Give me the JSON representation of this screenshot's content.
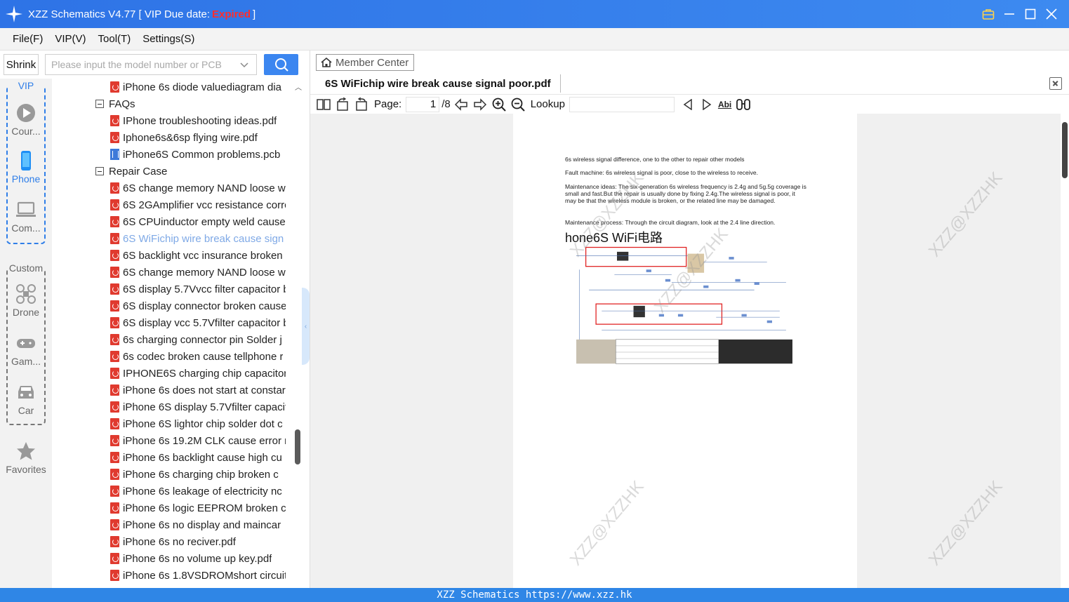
{
  "window": {
    "title_prefix": "XZZ Schematics V4.77 [ VIP Due date: ",
    "title_status": "Expired",
    "title_suffix": " ]",
    "accent_color": "#3b86f0",
    "expired_color": "#ff2d2d"
  },
  "menu": [
    "File(F)",
    "VIP(V)",
    "Tool(T)",
    "Settings(S)"
  ],
  "search": {
    "shrink_label": "Shrink",
    "placeholder": "Please input the model number or PCB"
  },
  "categories": {
    "vip_label": "VIP",
    "vip_items": [
      "Cour...",
      "Phone",
      "Com..."
    ],
    "custom_label": "Custom",
    "custom_items": [
      "Drone",
      "Gam...",
      "Car"
    ],
    "favorites": "Favorites"
  },
  "tree": {
    "rows": [
      {
        "type": "pdf",
        "label": "iPhone 6s diode valuediagram dia"
      },
      {
        "type": "folder",
        "label": "FAQs"
      },
      {
        "type": "pdf",
        "label": "IPhone troubleshooting ideas.pdf"
      },
      {
        "type": "pdf",
        "label": "Iphone6s&6sp flying wire.pdf"
      },
      {
        "type": "pcb",
        "label": "iPhone6S Common problems.pcb"
      },
      {
        "type": "folder",
        "label": "Repair Case"
      },
      {
        "type": "pdf",
        "label": "6S  change memory NAND loose w"
      },
      {
        "type": "pdf",
        "label": "6S 2GAmplifier vcc resistance corrc"
      },
      {
        "type": "pdf",
        "label": "6S CPUinductor empty weld cause"
      },
      {
        "type": "pdf",
        "label": "6S WiFichip wire break  cause sign",
        "selected": true
      },
      {
        "type": "pdf",
        "label": "6S backlight vcc insurance broken"
      },
      {
        "type": "pdf",
        "label": "6S change memory NAND loose w"
      },
      {
        "type": "pdf",
        "label": "6S display 5.7Vvcc filter capacitor b"
      },
      {
        "type": "pdf",
        "label": "6S display connector broken cause"
      },
      {
        "type": "pdf",
        "label": "6S display vcc 5.7Vfilter capacitor b"
      },
      {
        "type": "pdf",
        "label": "6s charging connector pin Solder j"
      },
      {
        "type": "pdf",
        "label": "6s codec broken cause tellphone r"
      },
      {
        "type": "pdf",
        "label": "IPHONE6S charging chip capacitor"
      },
      {
        "type": "pdf",
        "label": "iPhone 6s does not start at constar"
      },
      {
        "type": "pdf",
        "label": "iPhone 6S display 5.7Vfilter capacit"
      },
      {
        "type": "pdf",
        "label": "iPhone 6S lightor chip solder dot c"
      },
      {
        "type": "pdf",
        "label": "iPhone 6s  19.2M CLK cause error r"
      },
      {
        "type": "pdf",
        "label": "iPhone 6s  backlight cause high cu"
      },
      {
        "type": "pdf",
        "label": "iPhone 6s  charging chip broken c"
      },
      {
        "type": "pdf",
        "label": "iPhone 6s  leakage of electricity nc"
      },
      {
        "type": "pdf",
        "label": "iPhone 6s  logic EEPROM broken c"
      },
      {
        "type": "pdf",
        "label": "iPhone 6s  no display and maincar"
      },
      {
        "type": "pdf",
        "label": "iPhone 6s  no reciver.pdf"
      },
      {
        "type": "pdf",
        "label": "iPhone 6s  no volume up key.pdf"
      },
      {
        "type": "pdf",
        "label": "iPhone 6s 1.8VSDROMshort circuit"
      }
    ]
  },
  "viewer": {
    "member_center": "Member Center",
    "tab_title": "6S WiFichip wire break  cause signal poor.pdf",
    "page_label": "Page:",
    "page_current": "1",
    "page_total": "/8",
    "lookup_label": "Lookup",
    "abi_label": "Abi"
  },
  "document": {
    "line1": "6s wireless signal difference, one to the other to repair other models",
    "line2": "Fault machine: 6s wireless signal is poor, close to the wireless to receive.",
    "line3": "Maintenance ideas: The six-generation 6s wireless frequency is 2.4g and 5g.5g coverage is small and fast.But the repair is usually done by fixing 2.4g.The wireless signal is poor, it may be that the wireless module is broken, or the related line may be damaged.",
    "line4": "Maintenance process: Through the circuit diagram, look at the 2.4 line direction.",
    "diagram_title": "hone6S WiFi电路",
    "watermark": "XZZ@XZZHK"
  },
  "statusbar": "XZZ Schematics https://www.xzz.hk"
}
